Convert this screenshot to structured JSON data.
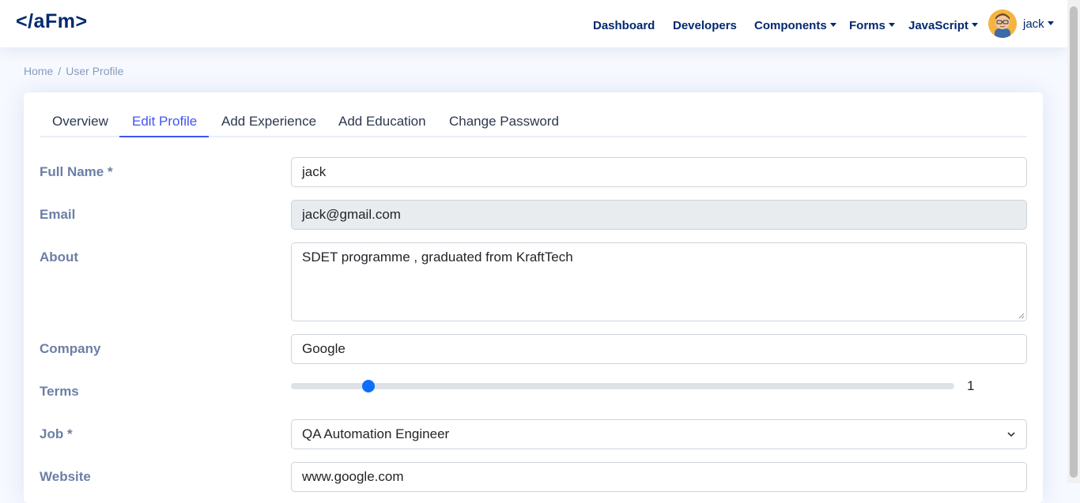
{
  "brand": {
    "logo": "</aFm>"
  },
  "nav": {
    "items": [
      {
        "label": "Dashboard",
        "has_dropdown": false
      },
      {
        "label": "Developers",
        "has_dropdown": false
      },
      {
        "label": "Components",
        "has_dropdown": true
      },
      {
        "label": "Forms",
        "has_dropdown": true
      },
      {
        "label": "JavaScript",
        "has_dropdown": true
      }
    ],
    "user": {
      "name": "jack",
      "avatar_icon": "user-avatar-icon"
    }
  },
  "breadcrumb": {
    "items": [
      "Home",
      "User Profile"
    ],
    "separator": "/"
  },
  "tabs": [
    {
      "label": "Overview",
      "active": false
    },
    {
      "label": "Edit Profile",
      "active": true
    },
    {
      "label": "Add Experience",
      "active": false
    },
    {
      "label": "Add Education",
      "active": false
    },
    {
      "label": "Change Password",
      "active": false
    }
  ],
  "form": {
    "full_name": {
      "label": "Full Name *",
      "value": "jack"
    },
    "email": {
      "label": "Email",
      "value": "jack@gmail.com",
      "disabled": true
    },
    "about": {
      "label": "About",
      "value": "SDET programme , graduated from KraftTech"
    },
    "company": {
      "label": "Company",
      "value": "Google"
    },
    "terms": {
      "label": "Terms",
      "value": "1",
      "min": 0,
      "max": 17,
      "fraction": 0.06
    },
    "job": {
      "label": "Job *",
      "value": "QA Automation Engineer"
    },
    "website": {
      "label": "Website",
      "value": "www.google.com"
    }
  },
  "colors": {
    "accent": "#4154f1",
    "navy": "#012970",
    "label": "#6b7fa6",
    "range_thumb": "#0d6efd",
    "page_bg": "#f6f9ff"
  }
}
